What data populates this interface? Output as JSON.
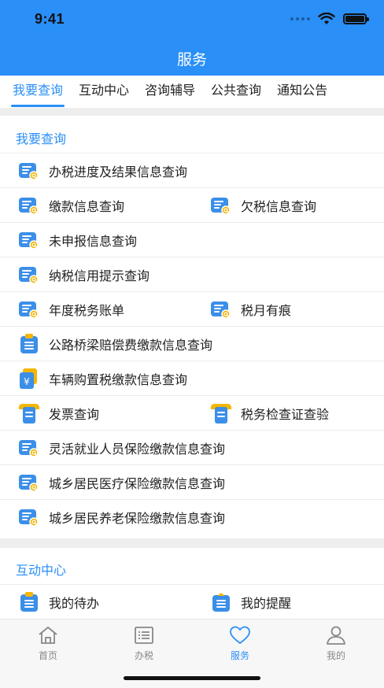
{
  "status": {
    "time": "9:41"
  },
  "header": {
    "title": "服务"
  },
  "tabs": [
    {
      "label": "我要查询",
      "active": true
    },
    {
      "label": "互动中心",
      "active": false
    },
    {
      "label": "咨询辅导",
      "active": false
    },
    {
      "label": "公共查询",
      "active": false
    },
    {
      "label": "通知公告",
      "active": false
    }
  ],
  "query_section": {
    "title": "我要查询",
    "items": [
      {
        "label": "办税进度及结果信息查询",
        "icon": "list-search-icon"
      },
      {
        "label": "缴款信息查询",
        "icon": "list-search-icon"
      },
      {
        "label": "欠税信息查询",
        "icon": "list-search-icon"
      },
      {
        "label": "未申报信息查询",
        "icon": "list-search-icon"
      },
      {
        "label": "纳税信用提示查询",
        "icon": "list-search-icon"
      },
      {
        "label": "年度税务账单",
        "icon": "list-search-icon"
      },
      {
        "label": "税月有痕",
        "icon": "list-search-icon"
      },
      {
        "label": "公路桥梁赔偿费缴款信息查询",
        "icon": "clipboard-icon"
      },
      {
        "label": "车辆购置税缴款信息查询",
        "icon": "yuan-receipt-icon"
      },
      {
        "label": "发票查询",
        "icon": "invoice-icon"
      },
      {
        "label": "税务检查证查验",
        "icon": "invoice-icon"
      },
      {
        "label": "灵活就业人员保险缴款信息查询",
        "icon": "list-search-icon"
      },
      {
        "label": "城乡居民医疗保险缴款信息查询",
        "icon": "list-search-icon"
      },
      {
        "label": "城乡居民养老保险缴款信息查询",
        "icon": "list-search-icon"
      }
    ]
  },
  "interaction_section": {
    "title": "互动中心",
    "items": [
      {
        "label": "我的待办",
        "icon": "clipboard-icon"
      },
      {
        "label": "我的提醒",
        "icon": "clipboard-bell-icon"
      }
    ]
  },
  "bottom_nav": [
    {
      "label": "首页",
      "icon": "home-icon",
      "active": false
    },
    {
      "label": "办税",
      "icon": "list-icon",
      "active": false
    },
    {
      "label": "服务",
      "icon": "heart-icon",
      "active": true
    },
    {
      "label": "我的",
      "icon": "person-icon",
      "active": false
    }
  ],
  "colors": {
    "primary": "#2a8ff7",
    "icon_blue": "#3b8fe8",
    "icon_yellow": "#f5b500"
  }
}
